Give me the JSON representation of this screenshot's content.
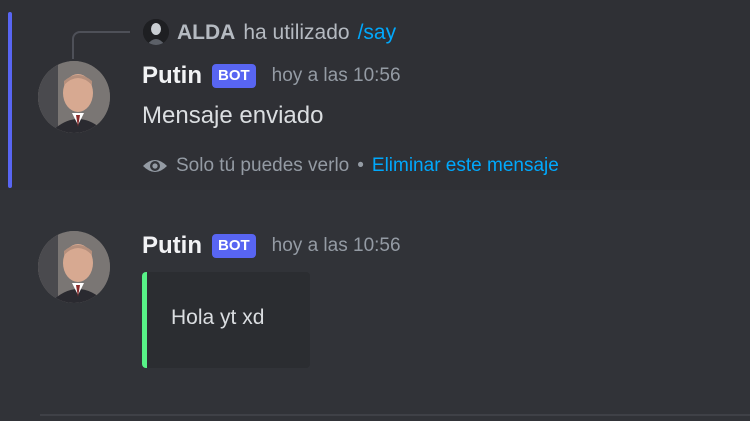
{
  "reply": {
    "user": "ALDA",
    "action": "ha utilizado",
    "command": "/say"
  },
  "message1": {
    "username": "Putin",
    "bot_tag": "BOT",
    "timestamp": "hoy a las 10:56",
    "content": "Mensaje enviado",
    "ephemeral_note": "Solo tú puedes verlo",
    "separator": "•",
    "delete_link": "Eliminar este mensaje"
  },
  "message2": {
    "username": "Putin",
    "bot_tag": "BOT",
    "timestamp": "hoy a las 10:56",
    "embed_text": "Hola yt xd"
  },
  "colors": {
    "background": "#313338",
    "highlight": "#5865f2",
    "link": "#00a8fc",
    "embed_accent": "#57f287"
  }
}
